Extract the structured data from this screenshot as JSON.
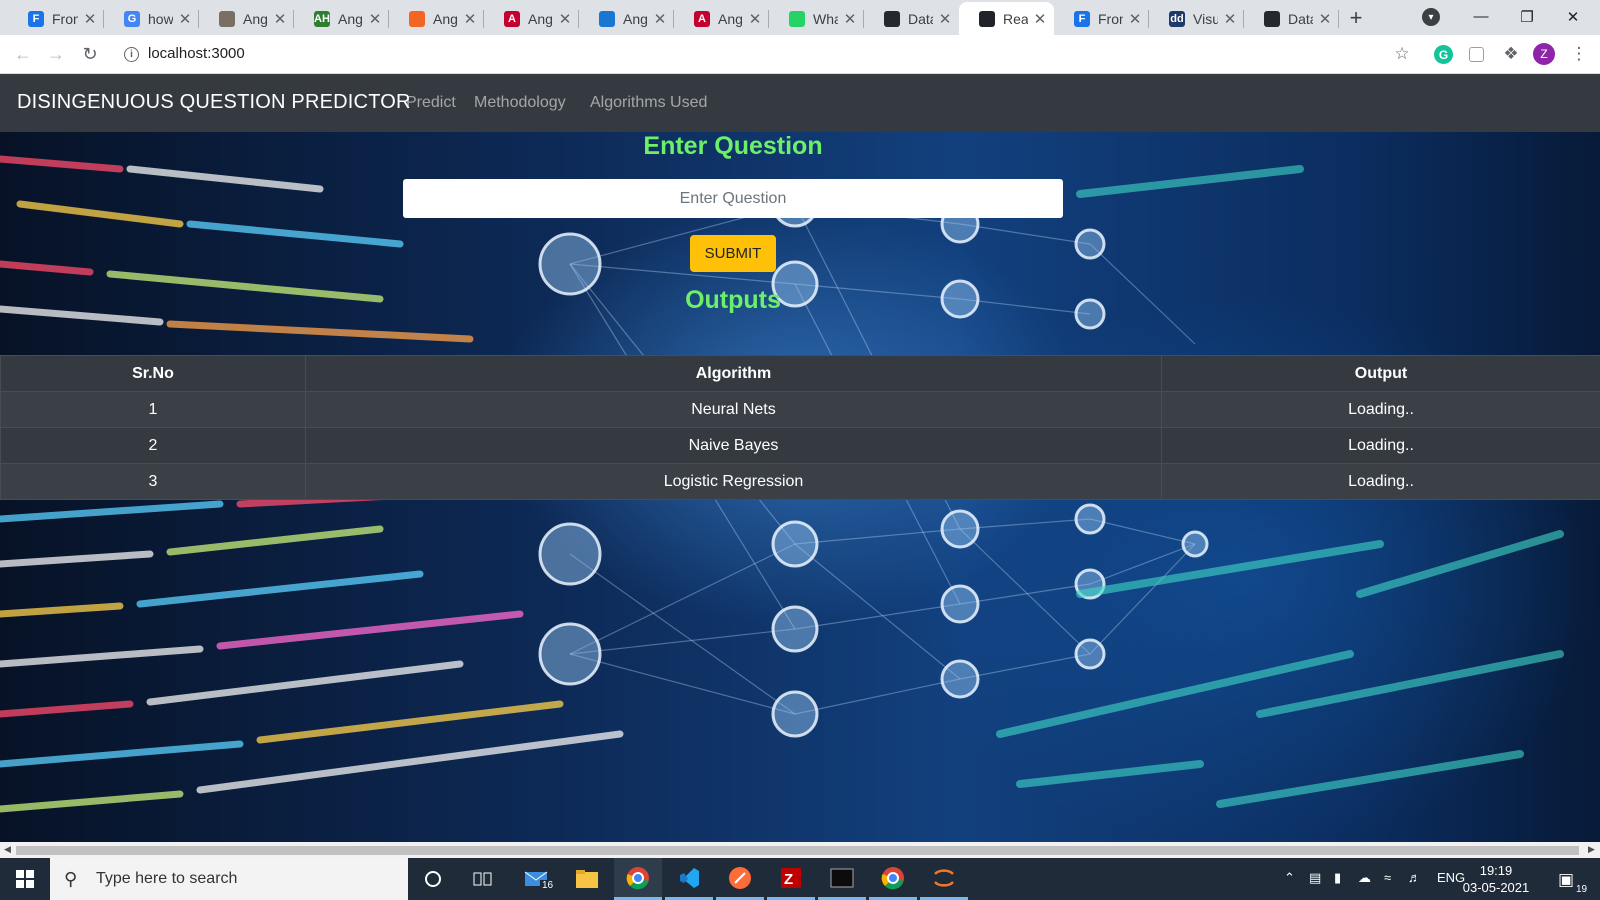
{
  "browser": {
    "tabs": [
      {
        "label": "Front",
        "favicon": "F",
        "color": "#1a73e8",
        "icon": "stackblitz-icon"
      },
      {
        "label": "how",
        "favicon": "G",
        "color": "#4285f4",
        "icon": "google-icon"
      },
      {
        "label": "Angu",
        "favicon": "",
        "color": "#7a6f63",
        "icon": "library-icon"
      },
      {
        "label": "Angu",
        "favicon": "AH",
        "color": "#2e7d32",
        "icon": "angular-hub-icon"
      },
      {
        "label": "Angu",
        "favicon": "",
        "color": "#f26522",
        "icon": "stackoverflow-icon"
      },
      {
        "label": "Angu",
        "favicon": "A",
        "color": "#c3002f",
        "icon": "angular-icon"
      },
      {
        "label": "Angu",
        "favicon": "",
        "color": "#1976d2",
        "icon": "lightning-icon"
      },
      {
        "label": "Angu",
        "favicon": "A",
        "color": "#c3002f",
        "icon": "angular-icon"
      },
      {
        "label": "Wha",
        "favicon": "",
        "color": "#25d366",
        "icon": "whatsapp-icon"
      },
      {
        "label": "Data",
        "favicon": "",
        "color": "#24292e",
        "icon": "github-icon"
      },
      {
        "label": "Reac",
        "favicon": "",
        "color": "#20232a",
        "icon": "react-icon"
      },
      {
        "label": "Fron",
        "favicon": "F",
        "color": "#1a73e8",
        "icon": "stackblitz-icon"
      },
      {
        "label": "Visu",
        "favicon": "dd",
        "color": "#1e3a6b",
        "icon": "visualization-icon"
      },
      {
        "label": "Data",
        "favicon": "",
        "color": "#24292e",
        "icon": "github-icon"
      }
    ],
    "active_tab_index": 10,
    "url": "localhost:3000",
    "profile_initial": "Z"
  },
  "site": {
    "brand": "DISINGENUOUS QUESTION PREDICTOR",
    "nav": [
      "Predict",
      "Methodology",
      "Algorithms Used"
    ],
    "heading": "Enter Question",
    "input_placeholder": "Enter Question",
    "input_value": "",
    "submit_label": "SUBMIT",
    "outputs_heading": "Outputs",
    "accent_color": "#6cf06a",
    "button_color": "#ffc107"
  },
  "results": {
    "columns": [
      "Sr.No",
      "Algorithm",
      "Output"
    ],
    "rows": [
      [
        "1",
        "Neural Nets",
        "Loading.."
      ],
      [
        "2",
        "Naive Bayes",
        "Loading.."
      ],
      [
        "3",
        "Logistic Regression",
        "Loading.."
      ]
    ]
  },
  "taskbar": {
    "search_placeholder": "Type here to search",
    "mail_badge": "16",
    "language": "ENG",
    "time": "19:19",
    "date": "03-05-2021",
    "notifications": "19"
  }
}
